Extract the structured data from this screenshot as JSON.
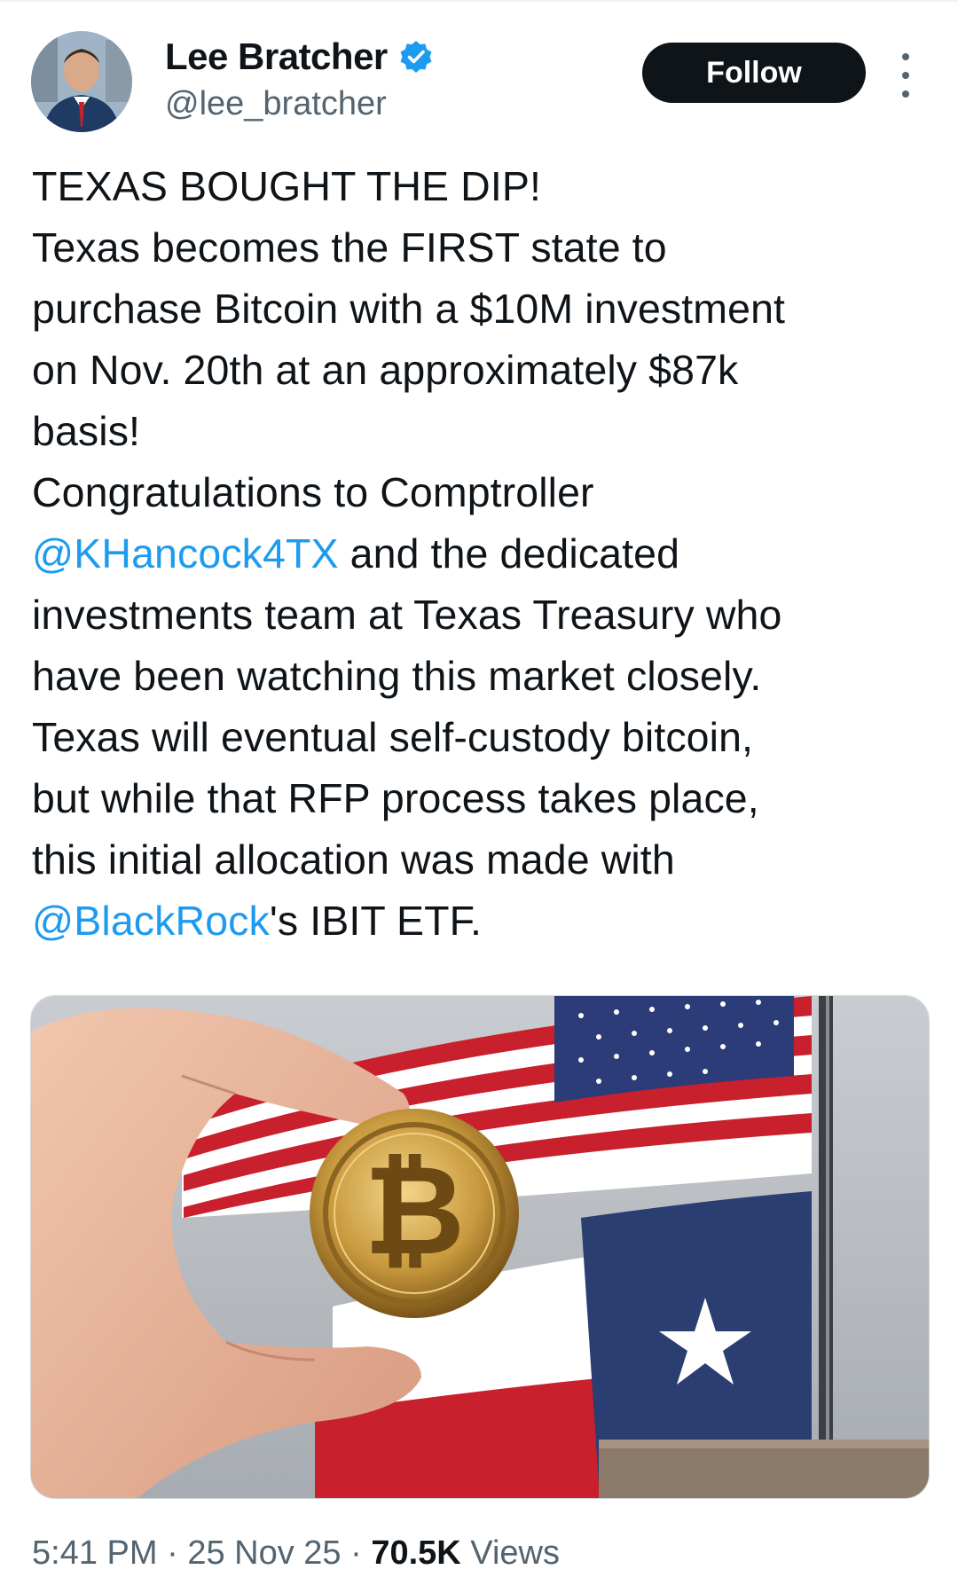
{
  "author": {
    "display_name": "Lee Bratcher",
    "handle": "@lee_bratcher",
    "verified_icon": "verified-badge-icon"
  },
  "follow_label": "Follow",
  "more_icon": "more-options-icon",
  "tweet": {
    "line1": "TEXAS BOUGHT THE DIP!",
    "line2": "Texas becomes the FIRST state to",
    "line3": "purchase Bitcoin with a $10M investment",
    "line4": "on Nov. 20th at an approximately $87k",
    "line5": "basis!",
    "line6": "Congratulations to Comptroller",
    "mention1": "@KHancock4TX",
    "line7_rest": " and the dedicated",
    "line8": "investments team at Texas Treasury who",
    "line9": "have been watching this market closely.",
    "line10": "Texas will eventual self-custody bitcoin,",
    "line11": "but while that RFP process takes place,",
    "line12": "this initial allocation was made with",
    "mention2": "@BlackRock",
    "line13_rest": "'s IBIT ETF."
  },
  "media": {
    "coin_icon": "bitcoin-symbol"
  },
  "meta": {
    "time": "5:41 PM",
    "sep1": " · ",
    "date": "25 Nov 25",
    "sep2": " · ",
    "views_count": "70.5K",
    "views_label": " Views"
  },
  "colors": {
    "accent": "#1d9bf0",
    "text": "#0f1419",
    "secondary": "#536471",
    "follow_bg": "#0f1419"
  }
}
